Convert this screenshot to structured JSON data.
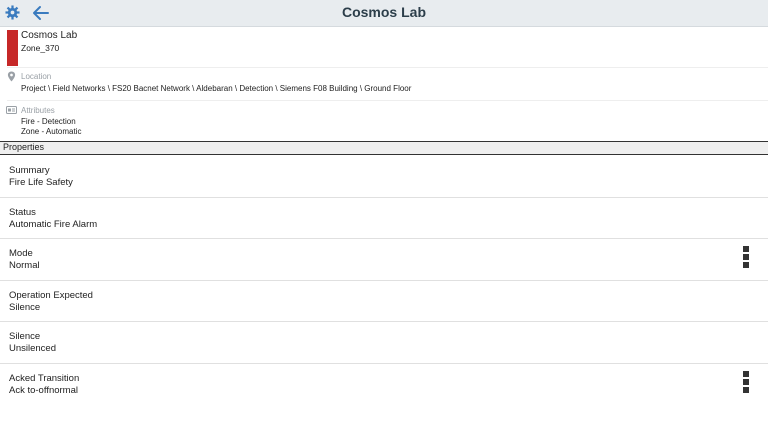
{
  "header": {
    "title": "Cosmos Lab",
    "settings_icon": "gear-icon",
    "back_icon": "arrow-left-icon"
  },
  "object": {
    "name": "Cosmos Lab",
    "id": "Zone_370",
    "color": "#c62828"
  },
  "location": {
    "label": "Location",
    "icon": "location-pin-icon",
    "path": "Project \\ Field Networks \\ FS20 Bacnet Network \\ Aldebaran \\ Detection \\ Siemens F08 Building \\ Ground Floor"
  },
  "attributes": {
    "label": "Attributes",
    "icon": "tag-icon",
    "items": [
      "Fire - Detection",
      "Zone - Automatic"
    ]
  },
  "properties": {
    "header": "Properties",
    "rows": [
      {
        "label": "Summary",
        "value": "Fire Life Safety",
        "has_menu": false
      },
      {
        "label": "Status",
        "value": "Automatic Fire Alarm",
        "has_menu": false
      },
      {
        "label": "Mode",
        "value": "Normal",
        "has_menu": true
      },
      {
        "label": "Operation Expected",
        "value": "Silence",
        "has_menu": false
      },
      {
        "label": "Silence",
        "value": "Unsilenced",
        "has_menu": false
      },
      {
        "label": "Acked Transition",
        "value": "Ack to-offnormal",
        "has_menu": true
      }
    ]
  }
}
